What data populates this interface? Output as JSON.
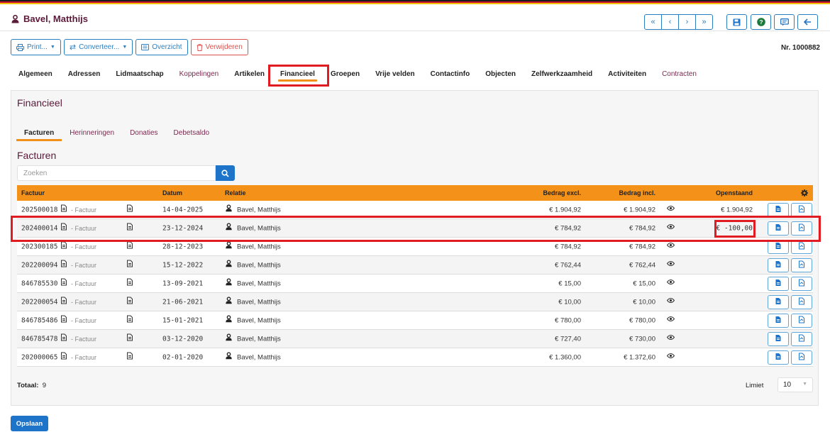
{
  "header": {
    "title": "Bavel, Matthijs",
    "flag_colors": [
      "#1a1a1a",
      "#c8102e",
      "#f2c200"
    ]
  },
  "nav": {
    "first": "«",
    "prev": "‹",
    "next": "›",
    "last": "»"
  },
  "toolbar": {
    "print": "Print...",
    "convert": "Converteer...",
    "overview": "Overzicht",
    "delete": "Verwijderen"
  },
  "record_number": "Nr. 1000882",
  "tabs": [
    "Algemeen",
    "Adressen",
    "Lidmaatschap",
    "Koppelingen",
    "Artikelen",
    "Financieel",
    "Groepen",
    "Vrije velden",
    "Contactinfo",
    "Objecten",
    "Zelfwerkzaamheid",
    "Activiteiten",
    "Contracten"
  ],
  "panel": {
    "title": "Financieel",
    "subtabs": [
      "Facturen",
      "Herinneringen",
      "Donaties",
      "Debetsaldo"
    ],
    "section_title": "Facturen",
    "search_placeholder": "Zoeken",
    "columns": {
      "factuur": "Factuur",
      "datum": "Datum",
      "relatie": "Relatie",
      "excl": "Bedrag excl.",
      "incl": "Bedrag incl.",
      "open": "Openstaand"
    },
    "rows": [
      {
        "nr": "202500018",
        "type": "- Factuur",
        "date": "14-04-2025",
        "rel": "Bavel, Matthijs",
        "excl": "€ 1.904,92",
        "incl": "€ 1.904,92",
        "open": "€ 1.904,92"
      },
      {
        "nr": "202400014",
        "type": "- Factuur",
        "date": "23-12-2024",
        "rel": "Bavel, Matthijs",
        "excl": "€ 784,92",
        "incl": "€ 784,92",
        "open": "€ -100,00"
      },
      {
        "nr": "202300185",
        "type": "- Factuur",
        "date": "28-12-2023",
        "rel": "Bavel, Matthijs",
        "excl": "€ 784,92",
        "incl": "€ 784,92",
        "open": ""
      },
      {
        "nr": "202200094",
        "type": "- Factuur",
        "date": "15-12-2022",
        "rel": "Bavel, Matthijs",
        "excl": "€ 762,44",
        "incl": "€ 762,44",
        "open": ""
      },
      {
        "nr": "846785530",
        "type": "- Factuur",
        "date": "13-09-2021",
        "rel": "Bavel, Matthijs",
        "excl": "€ 15,00",
        "incl": "€ 15,00",
        "open": ""
      },
      {
        "nr": "202200054",
        "type": "- Factuur",
        "date": "21-06-2021",
        "rel": "Bavel, Matthijs",
        "excl": "€ 10,00",
        "incl": "€ 10,00",
        "open": ""
      },
      {
        "nr": "846785486",
        "type": "- Factuur",
        "date": "15-01-2021",
        "rel": "Bavel, Matthijs",
        "excl": "€ 780,00",
        "incl": "€ 780,00",
        "open": ""
      },
      {
        "nr": "846785478",
        "type": "- Factuur",
        "date": "03-12-2020",
        "rel": "Bavel, Matthijs",
        "excl": "€ 727,40",
        "incl": "€ 730,00",
        "open": ""
      },
      {
        "nr": "202000065",
        "type": "- Factuur",
        "date": "02-01-2020",
        "rel": "Bavel, Matthijs",
        "excl": "€ 1.360,00",
        "incl": "€ 1.372,60",
        "open": ""
      }
    ],
    "total_label": "Totaal:",
    "total_value": "9",
    "limit_label": "Limiet",
    "limit_value": "10"
  },
  "save_label": "Opslaan"
}
